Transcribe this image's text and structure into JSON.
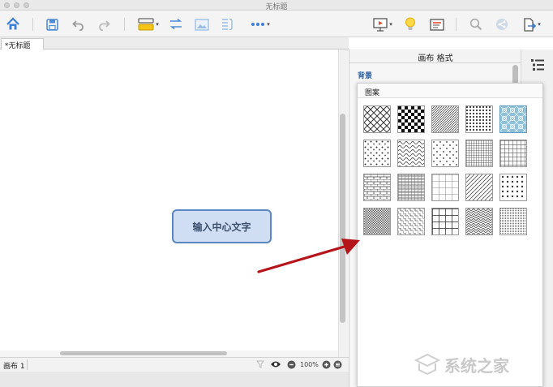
{
  "window": {
    "title": "无标题"
  },
  "toolbar": {
    "buttons": [
      {
        "name": "home",
        "icon": "home-icon"
      },
      {
        "name": "save",
        "icon": "save-icon"
      },
      {
        "name": "undo",
        "icon": "undo-icon"
      },
      {
        "name": "redo",
        "icon": "redo-icon"
      },
      {
        "name": "topic",
        "icon": "topic-icon"
      },
      {
        "name": "relationship",
        "icon": "relationship-icon"
      },
      {
        "name": "image",
        "icon": "image-icon"
      },
      {
        "name": "boundary",
        "icon": "boundary-icon"
      },
      {
        "name": "more",
        "icon": "more-icon"
      },
      {
        "name": "presentation",
        "icon": "presentation-icon"
      },
      {
        "name": "idea",
        "icon": "lightbulb-icon"
      },
      {
        "name": "outline",
        "icon": "outline-icon"
      },
      {
        "name": "search",
        "icon": "search-icon"
      },
      {
        "name": "share",
        "icon": "share-icon"
      },
      {
        "name": "export",
        "icon": "export-icon"
      }
    ],
    "accent_color": "#3d7fd6"
  },
  "tabs": [
    {
      "label": "*无标题"
    }
  ],
  "canvas": {
    "central_topic": {
      "text": "输入中心文字",
      "border_color": "#5a86c2",
      "fill_color": "#cfdef2"
    }
  },
  "statusbar": {
    "sheet_label": "画布 1",
    "zoom": "100%"
  },
  "sidebar": {
    "title": "画布 格式",
    "background_label": "背景"
  },
  "pattern_popup": {
    "title": "图案",
    "selected_index": 4,
    "selected_color": "#8fc1da",
    "patterns": [
      "diamond-lattice",
      "checkerboard",
      "fine-diagonal",
      "grid-dots",
      "ornamental-tile",
      "scatter-dots",
      "waves",
      "sparse-dots",
      "dense-grid",
      "square-grid",
      "brick-grid",
      "cross-hatch",
      "wide-grid",
      "diagonal-stripes",
      "polka-dots",
      "small-checks",
      "basket-weave",
      "heavy-grid",
      "herringbone",
      "fine-mesh"
    ]
  },
  "annotation": {
    "arrow_color": "#b5141b"
  },
  "watermark": {
    "text": "系统之家"
  }
}
